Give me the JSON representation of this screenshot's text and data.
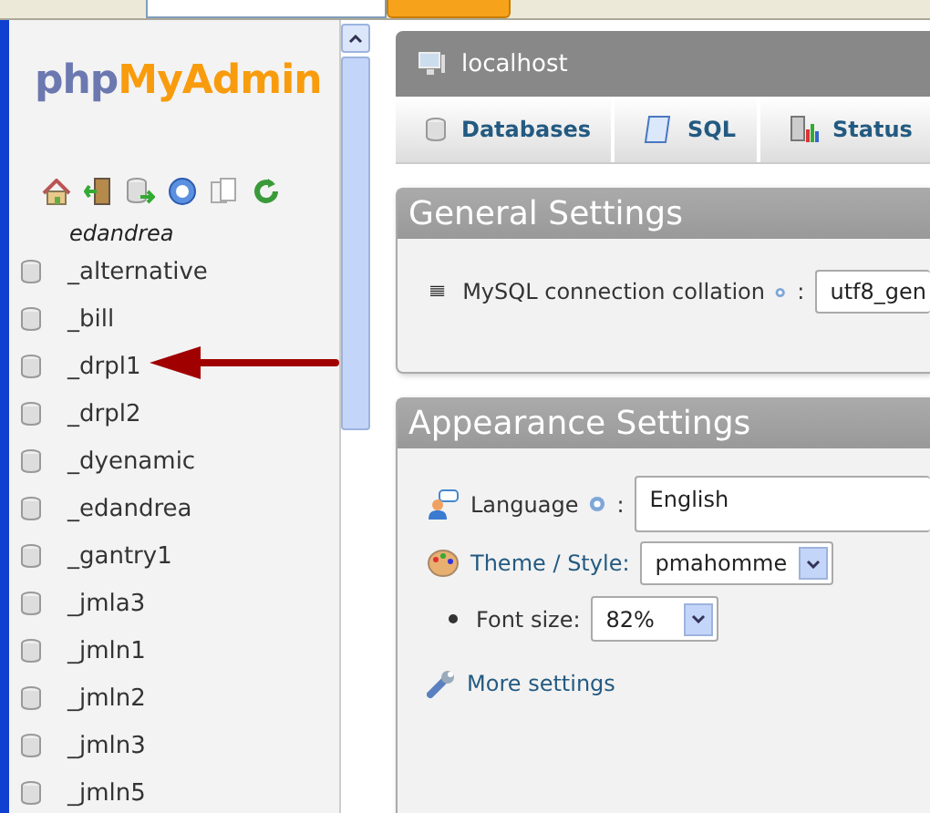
{
  "sidebar": {
    "logo": {
      "part_1": "php",
      "part_2": "MyAdmin"
    },
    "server_user": "edandrea",
    "databases": [
      "_alternative",
      "_bill",
      "_drpl1",
      "_drpl2",
      "_dyenamic",
      "_edandrea",
      "_gantry1",
      "_jmla3",
      "_jmln1",
      "_jmln2",
      "_jmln3",
      "_jmln5"
    ]
  },
  "server_bar": {
    "title": "localhost"
  },
  "tabs": [
    {
      "label": "Databases",
      "selected": false
    },
    {
      "label": "SQL",
      "selected": false
    },
    {
      "label": "Status",
      "selected": false
    }
  ],
  "general_settings": {
    "title": "General Settings",
    "collation_label": "MySQL connection collation",
    "collation_separator": ":",
    "collation_value": "utf8_gen"
  },
  "appearance_settings": {
    "title": "Appearance Settings",
    "language_label": "Language",
    "language_separator": ":",
    "language_value": "English",
    "theme_label": "Theme / Style:",
    "theme_value": "pmahomme",
    "font_size_label": "Font size:",
    "font_size_value": "82%",
    "more_settings": "More settings"
  }
}
